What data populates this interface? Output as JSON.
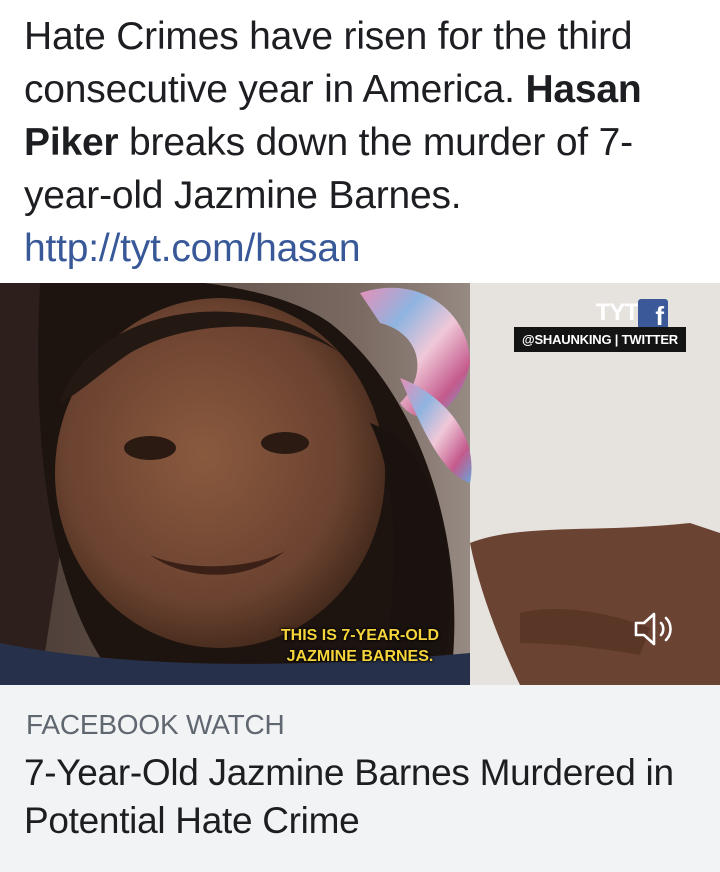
{
  "post": {
    "text_part1": "Hate Crimes have risen for the third consecutive year in America. ",
    "author_mention": "Hasan Piker",
    "text_part2": " breaks down the murder of 7-year-old Jazmine Barnes.",
    "link": "http://tyt.com/hasan"
  },
  "video": {
    "logo": "TYT",
    "fb_letter": "f",
    "source_tag": "@SHAUNKING | TWITTER",
    "caption_line1": "THIS IS 7-YEAR-OLD",
    "caption_line2": "JAZMINE BARNES.",
    "sound_icon": "speaker-icon"
  },
  "attachment": {
    "source": "FACEBOOK WATCH",
    "title": "7-Year-Old Jazmine Barnes Murdered in Potential Hate Crime"
  },
  "colors": {
    "link": "#385898",
    "caption": "#f5d53b",
    "facebook": "#3b5998",
    "footer_bg": "#f2f3f5"
  }
}
